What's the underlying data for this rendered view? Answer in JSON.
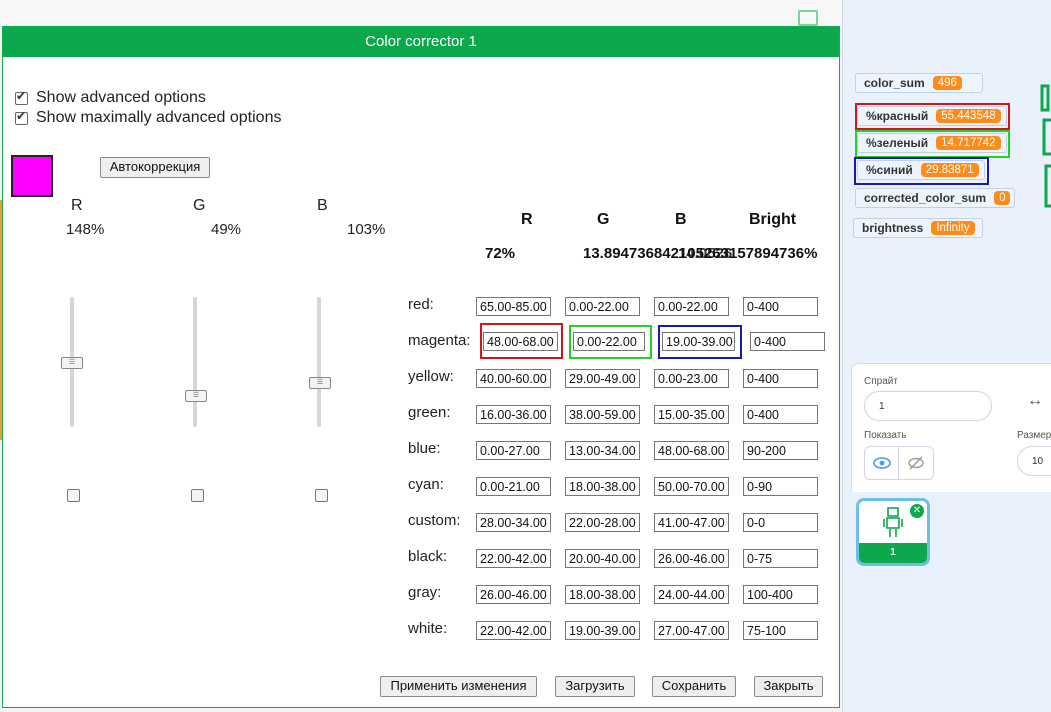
{
  "dialog": {
    "title": "Color corrector 1",
    "show_advanced": "Show advanced options",
    "show_max_advanced": "Show maximally advanced options",
    "swatch_color": "#ff00ff",
    "autocorrect_label": "Автокоррекция",
    "sliders": [
      {
        "label": "R",
        "percent": "148%",
        "level": 0.5
      },
      {
        "label": "G",
        "percent": "49%",
        "level": 0.25
      },
      {
        "label": "B",
        "percent": "103%",
        "level": 0.35
      }
    ],
    "table_headers": {
      "r": "R",
      "g": "G",
      "b": "B",
      "bright": "Bright"
    },
    "percent_row": {
      "r": "72%",
      "g_b_overlap": "13.894736842105263157894736%",
      "g_overlay": "14.0526"
    },
    "rows": [
      {
        "label": "red:",
        "r": "65.00-85.00",
        "g": "0.00-22.00",
        "b": "0.00-22.00",
        "bright": "0-400"
      },
      {
        "label": "magenta:",
        "r": "48.00-68.00",
        "g": "0.00-22.00",
        "b": "19.00-39.00",
        "bright": "0-400"
      },
      {
        "label": "yellow:",
        "r": "40.00-60.00",
        "g": "29.00-49.00",
        "b": "0.00-23.00",
        "bright": "0-400"
      },
      {
        "label": "green:",
        "r": "16.00-36.00",
        "g": "38.00-59.00",
        "b": "15.00-35.00",
        "bright": "0-400"
      },
      {
        "label": "blue:",
        "r": "0.00-27.00",
        "g": "13.00-34.00",
        "b": "48.00-68.00",
        "bright": "90-200"
      },
      {
        "label": "cyan:",
        "r": "0.00-21.00",
        "g": "18.00-38.00",
        "b": "50.00-70.00",
        "bright": "0-90"
      },
      {
        "label": "custom:",
        "r": "28.00-34.00",
        "g": "22.00-28.00",
        "b": "41.00-47.00",
        "bright": "0-0"
      },
      {
        "label": "black:",
        "r": "22.00-42.00",
        "g": "20.00-40.00",
        "b": "26.00-46.00",
        "bright": "0-75"
      },
      {
        "label": "gray:",
        "r": "26.00-46.00",
        "g": "18.00-38.00",
        "b": "24.00-44.00",
        "bright": "100-400"
      },
      {
        "label": "white:",
        "r": "22.00-42.00",
        "g": "19.00-39.00",
        "b": "27.00-47.00",
        "bright": "75-100"
      }
    ],
    "buttons": {
      "apply": "Применить изменения",
      "load": "Загрузить",
      "save": "Сохранить",
      "close": "Закрыть"
    }
  },
  "variables": [
    {
      "name": "color_sum",
      "value": "496"
    },
    {
      "name": "%красный",
      "value": "55.443548"
    },
    {
      "name": "%зеленый",
      "value": "14.717742"
    },
    {
      "name": "%синий",
      "value": "29.83871"
    },
    {
      "name": "corrected_color_sum",
      "value": "0"
    },
    {
      "name": "brightness",
      "value": "Infinity"
    }
  ],
  "sprite_panel": {
    "sprite_label": "Спрайт",
    "sprite_name": "1",
    "show_label": "Показать",
    "size_label": "Размер",
    "size_value": "10",
    "thumb_number": "1"
  },
  "colors": {
    "accent_green": "#0ca94c",
    "highlight_red": "#d4141c",
    "highlight_green": "#25d025",
    "highlight_blue": "#1a1ab0",
    "variable_value_orange": "#ff8c1a"
  }
}
